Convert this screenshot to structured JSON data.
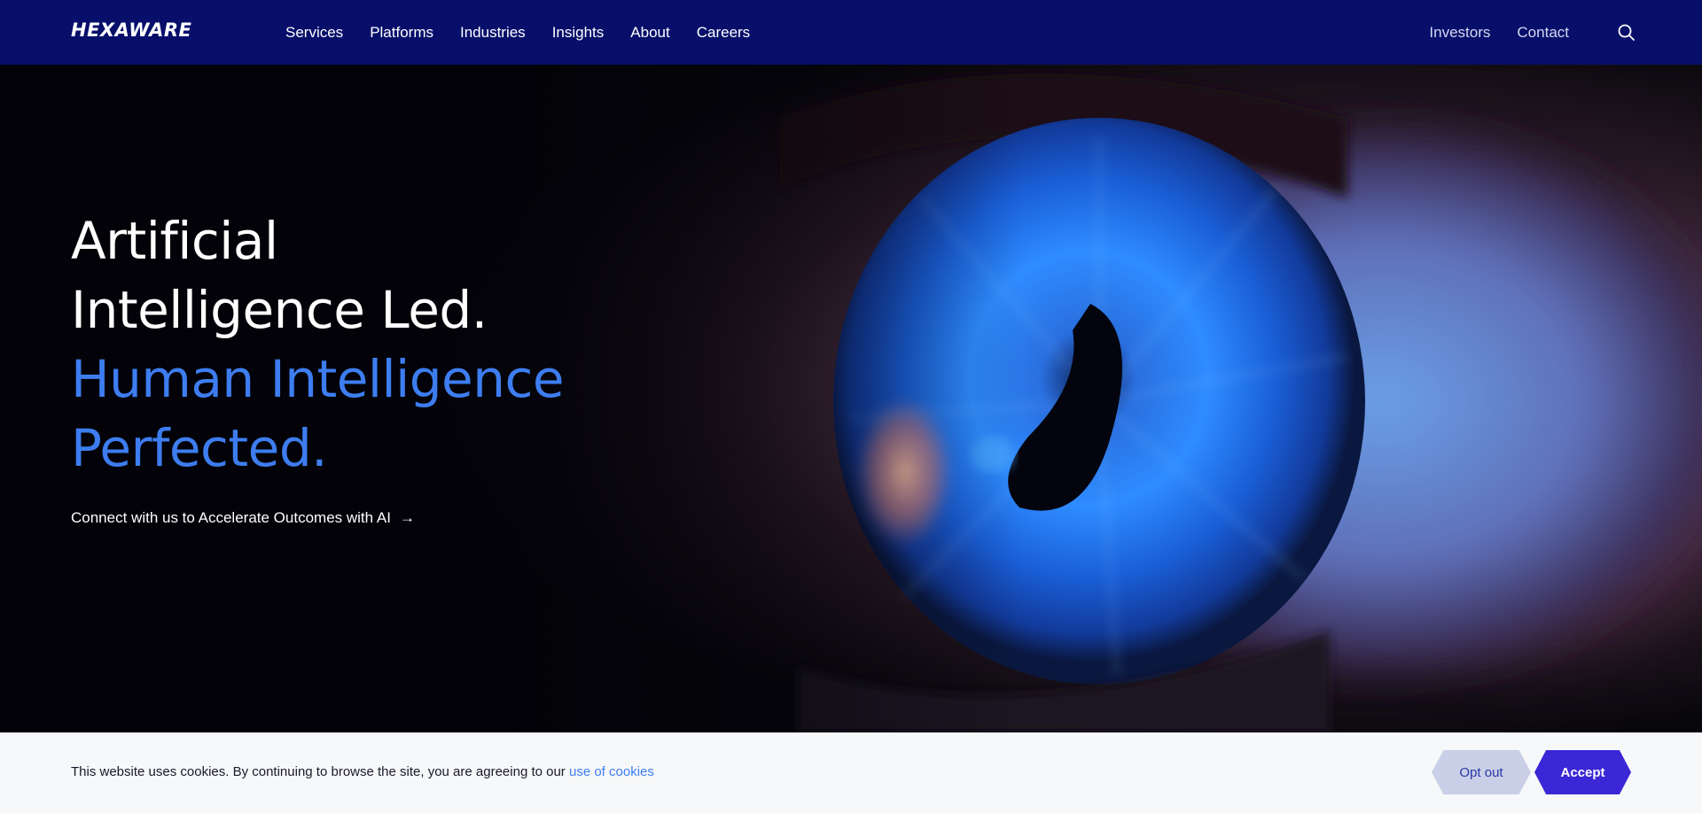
{
  "header": {
    "logo": "HEXAWARE",
    "nav_main": [
      "Services",
      "Platforms",
      "Industries",
      "Insights",
      "About",
      "Careers"
    ],
    "nav_right": [
      "Investors",
      "Contact"
    ],
    "search_icon": "search-icon"
  },
  "hero": {
    "line1": "Artificial",
    "line2": "Intelligence Led.",
    "line3": "Human Intelligence",
    "line4": "Perfected.",
    "cta_label": "Connect with us to Accelerate Outcomes with AI",
    "cta_icon": "arrow-right-icon",
    "colors": {
      "header_bg": "#070f6b",
      "accent_blue": "#3d7df0"
    }
  },
  "cookie": {
    "text": "This website uses cookies. By continuing to browse the site, you are agreeing to our ",
    "link_label": "use of cookies",
    "opt_out_label": "Opt out",
    "accept_label": "Accept",
    "colors": {
      "opt_out_bg": "#c9cfe6",
      "accept_bg": "#3a27d6"
    }
  }
}
